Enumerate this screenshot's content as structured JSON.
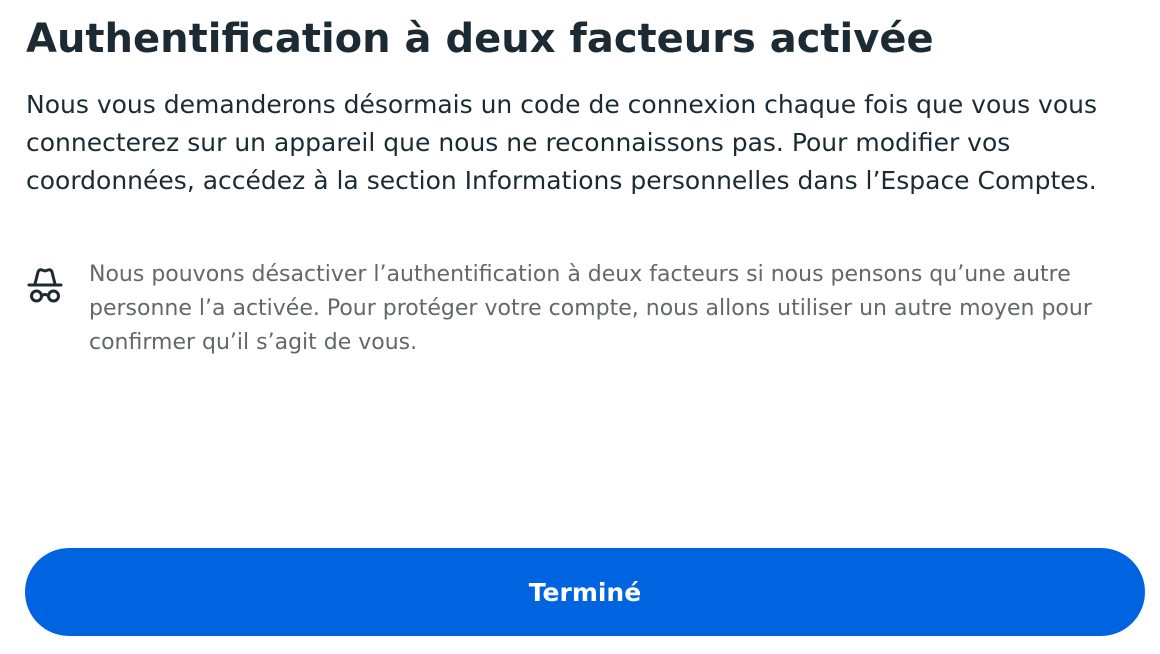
{
  "dialog": {
    "title": "Authentification à deux facteurs activée",
    "description": "Nous vous demanderons désormais un code de connexion chaque fois que vous vous connecterez sur un appareil que nous ne reconnaissons pas. Pour modifier vos coordonnées, accédez à la section Informations personnelles dans l’Espace Comptes.",
    "notice": {
      "icon": "incognito-icon",
      "text": "Nous pouvons désactiver l’authentification à deux facteurs si nous pensons qu’une autre personne l’a activée. Pour protéger votre compte, nous allons utiliser un autre moyen pour confirmer qu’il s’agit de vous."
    },
    "done_button": {
      "label": "Terminé"
    }
  },
  "colors": {
    "primary": "#0064e0",
    "title_text": "#1c2b33",
    "secondary_text": "#65676b",
    "background": "#ffffff"
  }
}
